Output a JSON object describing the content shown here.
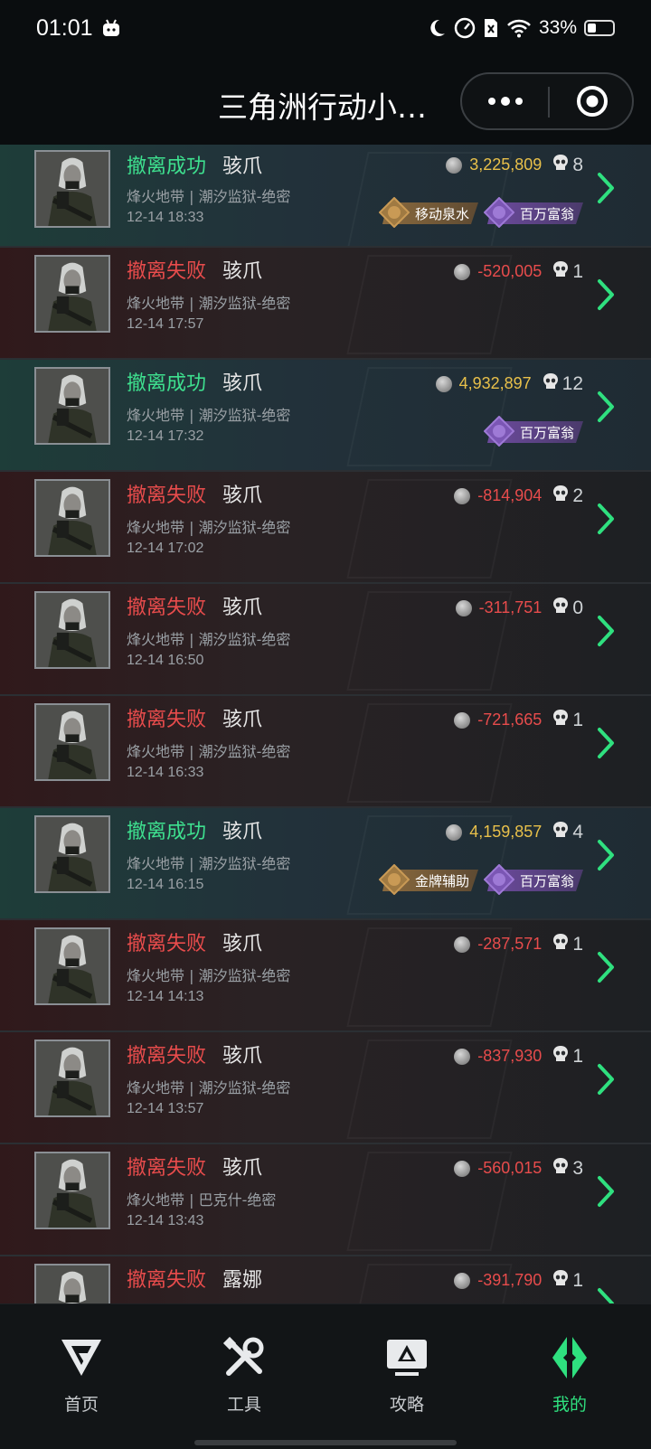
{
  "status_bar": {
    "time": "01:01",
    "battery": "33%"
  },
  "header": {
    "title": "三角洲行动小…"
  },
  "records": [
    {
      "result": "撤离成功",
      "status": "success",
      "operator": "骇爪",
      "map": "烽火地带 | 潮汐监狱-绝密",
      "time": "12-14 18:33",
      "value": "3,225,809",
      "kills": "8",
      "badges": [
        {
          "label": "移动泉水",
          "style": "gold"
        },
        {
          "label": "百万富翁",
          "style": "purple"
        }
      ]
    },
    {
      "result": "撤离失败",
      "status": "fail",
      "operator": "骇爪",
      "map": "烽火地带 | 潮汐监狱-绝密",
      "time": "12-14 17:57",
      "value": "-520,005",
      "kills": "1",
      "badges": []
    },
    {
      "result": "撤离成功",
      "status": "success",
      "operator": "骇爪",
      "map": "烽火地带 | 潮汐监狱-绝密",
      "time": "12-14 17:32",
      "value": "4,932,897",
      "kills": "12",
      "badges": [
        {
          "label": "百万富翁",
          "style": "purple"
        }
      ]
    },
    {
      "result": "撤离失败",
      "status": "fail",
      "operator": "骇爪",
      "map": "烽火地带 | 潮汐监狱-绝密",
      "time": "12-14 17:02",
      "value": "-814,904",
      "kills": "2",
      "badges": []
    },
    {
      "result": "撤离失败",
      "status": "fail",
      "operator": "骇爪",
      "map": "烽火地带 | 潮汐监狱-绝密",
      "time": "12-14 16:50",
      "value": "-311,751",
      "kills": "0",
      "badges": []
    },
    {
      "result": "撤离失败",
      "status": "fail",
      "operator": "骇爪",
      "map": "烽火地带 | 潮汐监狱-绝密",
      "time": "12-14 16:33",
      "value": "-721,665",
      "kills": "1",
      "badges": []
    },
    {
      "result": "撤离成功",
      "status": "success",
      "operator": "骇爪",
      "map": "烽火地带 | 潮汐监狱-绝密",
      "time": "12-14 16:15",
      "value": "4,159,857",
      "kills": "4",
      "badges": [
        {
          "label": "金牌辅助",
          "style": "gold"
        },
        {
          "label": "百万富翁",
          "style": "purple"
        }
      ]
    },
    {
      "result": "撤离失败",
      "status": "fail",
      "operator": "骇爪",
      "map": "烽火地带 | 潮汐监狱-绝密",
      "time": "12-14 14:13",
      "value": "-287,571",
      "kills": "1",
      "badges": []
    },
    {
      "result": "撤离失败",
      "status": "fail",
      "operator": "骇爪",
      "map": "烽火地带 | 潮汐监狱-绝密",
      "time": "12-14 13:57",
      "value": "-837,930",
      "kills": "1",
      "badges": []
    },
    {
      "result": "撤离失败",
      "status": "fail",
      "operator": "骇爪",
      "map": "烽火地带 | 巴克什-绝密",
      "time": "12-14 13:43",
      "value": "-560,015",
      "kills": "3",
      "badges": []
    },
    {
      "result": "撤离失败",
      "status": "fail",
      "operator": "露娜",
      "map": "",
      "time": "",
      "value": "-391,790",
      "kills": "1",
      "badges": []
    }
  ],
  "nav": [
    {
      "label": "首页",
      "icon": "home-logo-icon",
      "active": false
    },
    {
      "label": "工具",
      "icon": "tools-icon",
      "active": false
    },
    {
      "label": "攻略",
      "icon": "guide-monitor-icon",
      "active": false
    },
    {
      "label": "我的",
      "icon": "mine-logo-icon",
      "active": true
    }
  ],
  "colors": {
    "success": "#3ee08f",
    "fail": "#e84c4c",
    "gain": "#e8c04a",
    "active_nav": "#2fe07f"
  }
}
